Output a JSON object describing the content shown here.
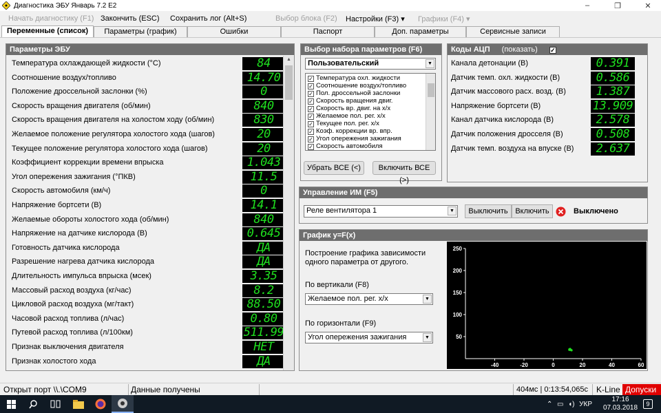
{
  "window": {
    "title": "Диагностика ЭБУ Январь 7.2 Е2",
    "minimize": "–",
    "maximize": "❐",
    "close": "✕"
  },
  "menu": [
    {
      "label": "Начать диагностику (F1)",
      "disabled": true
    },
    {
      "label": "Закончить (ESC)",
      "disabled": false
    },
    {
      "label": "Сохранить лог (Alt+S)",
      "disabled": false
    },
    {
      "label": "Выбор блока (F2)",
      "disabled": true
    },
    {
      "label": "Настройки (F3) ▾",
      "disabled": false
    },
    {
      "label": "Графики (F4) ▾",
      "disabled": true
    }
  ],
  "tabs": [
    {
      "label": "Переменные (список)",
      "active": true
    },
    {
      "label": "Параметры (график)",
      "active": false
    },
    {
      "label": "Ошибки",
      "active": false
    },
    {
      "label": "Паспорт",
      "active": false
    },
    {
      "label": "Доп. параметры",
      "active": false
    },
    {
      "label": "Сервисные записи",
      "active": false
    }
  ],
  "ecu_params": {
    "title": "Параметры ЭБУ",
    "rows": [
      {
        "label": "Температура охлаждающей жидкости (°C)",
        "value": "84"
      },
      {
        "label": "Соотношение воздух/топливо",
        "value": "14.70"
      },
      {
        "label": "Положение дроссельной заслонки (%)",
        "value": "0"
      },
      {
        "label": "Скорость вращения двигателя (об/мин)",
        "value": "840"
      },
      {
        "label": "Скорость вращения двигателя на холостом ходу (об/мин)",
        "value": "830"
      },
      {
        "label": "Желаемое положение регулятора холостого хода (шагов)",
        "value": "20"
      },
      {
        "label": "Текущее положение регулятора холостого хода (шагов)",
        "value": "20"
      },
      {
        "label": "Коэффициент коррекции времени впрыска",
        "value": "1.043"
      },
      {
        "label": "Угол опережения зажигания (°ПКВ)",
        "value": "11.5"
      },
      {
        "label": "Скорость автомобиля (км/ч)",
        "value": "0"
      },
      {
        "label": "Напряжение бортсети (В)",
        "value": "14.1"
      },
      {
        "label": "Желаемые обороты холостого хода (об/мин)",
        "value": "840"
      },
      {
        "label": "Напряжение на датчике кислорода (В)",
        "value": "0.645"
      },
      {
        "label": "Готовность датчика кислорода",
        "value": "ДА"
      },
      {
        "label": "Разрешение нагрева датчика кислорода",
        "value": "ДА"
      },
      {
        "label": "Длительность импульса впрыска (мсек)",
        "value": "3.35"
      },
      {
        "label": "Массовый расход воздуха (кг/час)",
        "value": "8.2"
      },
      {
        "label": "Цикловой расход воздуха (мг/такт)",
        "value": "88.50"
      },
      {
        "label": "Часовой расход топлива (л/час)",
        "value": "0.80"
      },
      {
        "label": "Путевой расход топлива (л/100км)",
        "value": "511.99"
      },
      {
        "label": "Признак выключения двигателя",
        "value": "НЕТ"
      },
      {
        "label": "Признак холостого хода",
        "value": "ДА"
      }
    ]
  },
  "param_set": {
    "title": "Выбор набора параметров (F6)",
    "selected": "Пользовательский",
    "items": [
      "Температура охл. жидкости",
      "Соотношение воздух/топливо",
      "Пол. дроссельной заслонки",
      "Скорость вращения двиг.",
      "Скорость вр. двиг. на х/х",
      "Желаемое пол. рег. х/х",
      "Текущее пол. рег. х/х",
      "Коэф. коррекции вр. впр.",
      "Угол опережения зажигания",
      "Скорость автомобиля"
    ],
    "remove_all": "Убрать ВСЕ (<)",
    "add_all": "Включить ВСЕ (>)"
  },
  "adc": {
    "title": "Коды АЦП",
    "show_label": "(показать)",
    "rows": [
      {
        "label": "Канала детонации (В)",
        "value": "0.391"
      },
      {
        "label": "Датчик темп. охл. жидкости (В)",
        "value": "0.586"
      },
      {
        "label": "Датчик массового расх. возд. (В)",
        "value": "1.387"
      },
      {
        "label": "Напряжение бортсети (В)",
        "value": "13.909"
      },
      {
        "label": "Канал датчика кислорода (В)",
        "value": "2.578"
      },
      {
        "label": "Датчик положения дросселя (В)",
        "value": "0.508"
      },
      {
        "label": "Датчик темп. воздуха на впуске (В)",
        "value": "2.637"
      }
    ]
  },
  "actuator": {
    "title": "Управление ИМ (F5)",
    "selected": "Реле вентилятора 1",
    "off_button": "Выключить",
    "on_button": "Включить",
    "state": "Выключено"
  },
  "graph": {
    "title": "График y=F(x)",
    "description": "Построение графика зависимости одного параметра от другого.",
    "vertical_label": "По вертикали (F8)",
    "vertical_selected": "Желаемое пол. рег. х/х",
    "horizontal_label": "По горизонтали (F9)",
    "horizontal_selected": "Угол опережения зажигания"
  },
  "chart_data": {
    "type": "scatter",
    "title": "",
    "xlabel": "",
    "ylabel": "",
    "xlim": [
      -60,
      60
    ],
    "ylim": [
      0,
      250
    ],
    "x_ticks": [
      -40,
      -20,
      0,
      20,
      40,
      60
    ],
    "y_ticks": [
      50,
      100,
      150,
      200,
      250
    ],
    "point_color": "#1fe01f",
    "background": "#000000",
    "points": [
      [
        11,
        20
      ],
      [
        11.5,
        20
      ],
      [
        12,
        20
      ],
      [
        11,
        21
      ],
      [
        12.5,
        19
      ],
      [
        11.5,
        22
      ]
    ]
  },
  "status": {
    "port": "Открыт порт \\\\.\\COM9",
    "message": "Данные получены",
    "timing": "404мс | 0:13:54,065с",
    "protocol": "K-Line",
    "tolerance": "Допуски",
    "tolerance_color": "#e00000"
  },
  "taskbar": {
    "lang": "УКР",
    "time": "17:16",
    "date": "07.03.2018",
    "notifications": "9"
  }
}
